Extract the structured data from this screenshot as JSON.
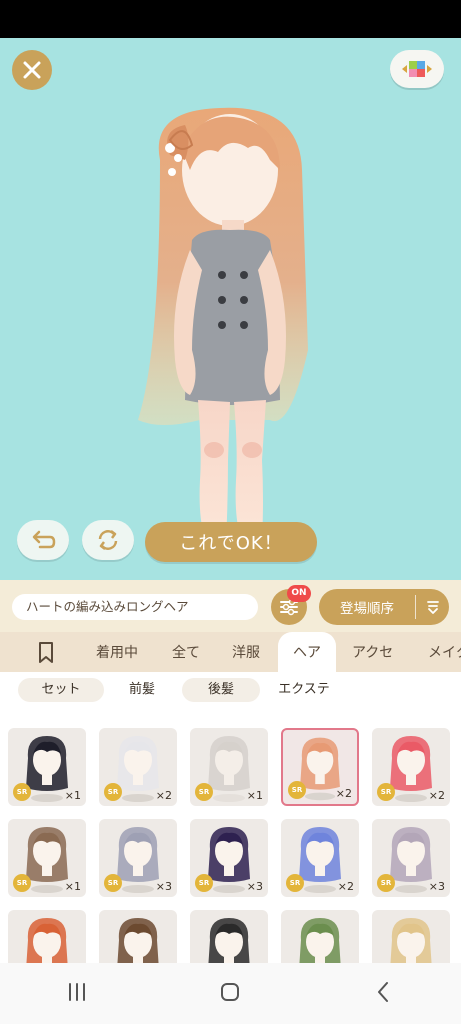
{
  "controls": {
    "ok_label": "これでOK！"
  },
  "item_name": "ハートの編み込みロングヘア",
  "filter_badge": "ON",
  "sort_label": "登場順序",
  "tabs": [
    "着用中",
    "全て",
    "洋服",
    "ヘア",
    "アクセ",
    "メイク"
  ],
  "active_tab": "ヘア",
  "subtabs": [
    "セット",
    "前髪",
    "後髪",
    "エクステ"
  ],
  "active_subtab": "前髪",
  "items": [
    {
      "rarity": "SR",
      "qty": "×1",
      "hair_color": "#1e1e2a",
      "state": "normal"
    },
    {
      "rarity": "SR",
      "qty": "×2",
      "hair_color": "#e6e6ea",
      "state": "normal"
    },
    {
      "rarity": "SR",
      "qty": "×1",
      "hair_color": "#b9b3ae",
      "state": "faded"
    },
    {
      "rarity": "SR",
      "qty": "×2",
      "hair_color": "#e79a74",
      "state": "selected"
    },
    {
      "rarity": "SR",
      "qty": "×2",
      "hair_color": "#ea5a66",
      "state": "normal"
    },
    {
      "rarity": "SR",
      "qty": "×1",
      "hair_color": "#8a6a52",
      "state": "normal"
    },
    {
      "rarity": "SR",
      "qty": "×3",
      "hair_color": "#9ea0b4",
      "state": "normal"
    },
    {
      "rarity": "SR",
      "qty": "×3",
      "hair_color": "#2e2150",
      "state": "normal"
    },
    {
      "rarity": "SR",
      "qty": "×2",
      "hair_color": "#6f84dc",
      "state": "normal"
    },
    {
      "rarity": "SR",
      "qty": "×3",
      "hair_color": "#b3a6b8",
      "state": "normal"
    },
    {
      "rarity": "",
      "qty": "",
      "hair_color": "#d86236",
      "state": "normal"
    },
    {
      "rarity": "",
      "qty": "",
      "hair_color": "#6c4a30",
      "state": "normal"
    },
    {
      "rarity": "",
      "qty": "",
      "hair_color": "#2a2a2a",
      "state": "normal"
    },
    {
      "rarity": "",
      "qty": "",
      "hair_color": "#6b8e4e",
      "state": "normal"
    },
    {
      "rarity": "",
      "qty": "",
      "hair_color": "#e1c48a",
      "state": "normal"
    }
  ],
  "colors": {
    "stage_bg": "#a7e3e1",
    "gold": "#c9a25a",
    "selected_border": "#e2788a",
    "badge_red": "#ef4a4a",
    "sr_badge": "#e3b53a"
  },
  "icons": {
    "close": "close-icon",
    "cube": "color-cube-icon",
    "undo": "undo-icon",
    "refresh": "refresh-icon",
    "bookmark": "bookmark-icon",
    "filter": "filter-sliders-icon",
    "sort": "sort-icon",
    "nav_recent": "recent-apps-icon",
    "nav_home": "home-icon",
    "nav_back": "back-icon"
  }
}
